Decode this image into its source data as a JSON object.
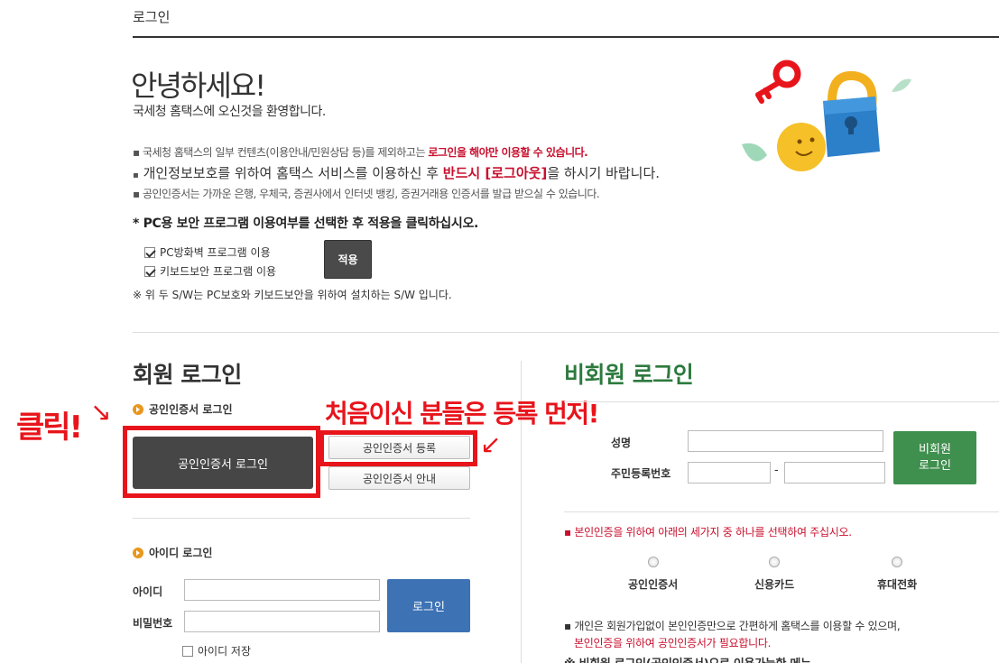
{
  "page": {
    "title": "로그인"
  },
  "hero": {
    "hello": "안녕하세요!",
    "welcome": "국세청 홈택스에 오신것을 환영합니다."
  },
  "notices": {
    "n1_prefix": "국세청 홈택스의 일부 컨텐츠(이용안내/민원상담 등)를 제외하고는 ",
    "n1_emphasis": "로그인을 해야만 이용할 수 있습니다.",
    "n2_prefix": "개인정보보호를 위하여 홈택스 서비스를 이용하신 후 ",
    "n2_emphasis": "반드시 [로그아웃]",
    "n2_suffix": "을 하시기 바랍니다.",
    "n3": "공인인증서는 가까운 은행, 우체국, 증권사에서 인터넷 뱅킹, 증권거래용 인증서를 발급 받으실 수 있습니다."
  },
  "security": {
    "title": "* PC용 보안 프로그램 이용여부를 선택한 후 적용을 클릭하십시오.",
    "options": [
      {
        "label": "PC방화벽 프로그램 이용",
        "checked": true
      },
      {
        "label": "키보드보안 프로그램 이용",
        "checked": true
      }
    ],
    "apply_label": "적용",
    "note": "※ 위 두 S/W는 PC보호와 키보드보안을 위하여 설치하는 S/W 입니다."
  },
  "member": {
    "heading": "회원 로그인",
    "cert_section": "공인인증서 로그인",
    "cert_login_button": "공인인증서 로그인",
    "cert_register_button": "공인인증서 등록",
    "cert_guide_button": "공인인증서 안내",
    "id_section": "아이디 로그인",
    "id_label": "아이디",
    "pw_label": "비밀번호",
    "login_button": "로그인",
    "save_id": "아이디 저장"
  },
  "annotations": {
    "click": "클릭!",
    "click_arrow": "↘",
    "first_register": "처음이신 분들은 등록 먼저!",
    "register_arrow": "↙"
  },
  "nonmember": {
    "heading": "비회원 로그인",
    "name_label": "성명",
    "rrn_label": "주민등록번호",
    "rrn_dash": "-",
    "login_button_line1": "비회원",
    "login_button_line2": "로그인",
    "select_notice": "본인인증을 위하여 아래의 세가지 중 하나를 선택하여 주십시오.",
    "methods": [
      "공인인증서",
      "신용카드",
      "휴대전화"
    ],
    "info_line1": "개인은 회원가입없이 본인인증만으로 간편하게 홈택스를 이용할 수 있으며,",
    "info_line2": "본인인증을 위하여 공인인증서가 필요합니다.",
    "menu_note": "※ 비회원 로그인(공인인증서)으로 이용가능한 메뉴"
  },
  "colors": {
    "accent_red": "#c8102e",
    "annotation_red": "#e8141b",
    "member_dark": "#464646",
    "login_blue": "#3d72b4",
    "nonmember_green": "#3f8f4e"
  }
}
